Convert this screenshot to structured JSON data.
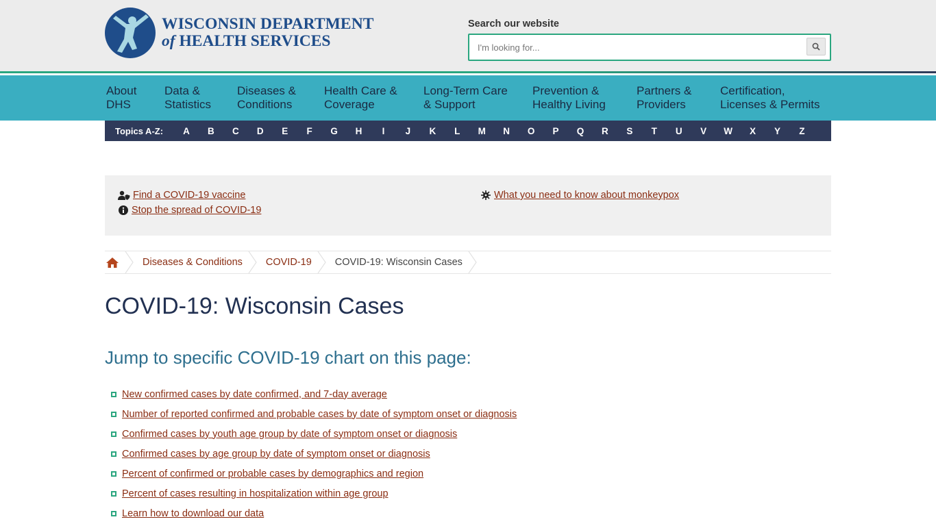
{
  "header": {
    "logo_line1": "WISCONSIN DEPARTMENT",
    "logo_of": "of",
    "logo_line2": "HEALTH SERVICES",
    "search_label": "Search our website",
    "search_placeholder": "I'm looking for..."
  },
  "mainnav": {
    "items": [
      {
        "label": "About\nDHS"
      },
      {
        "label": "Data &\nStatistics"
      },
      {
        "label": "Diseases &\nConditions"
      },
      {
        "label": "Health Care &\nCoverage"
      },
      {
        "label": "Long-Term Care\n& Support"
      },
      {
        "label": "Prevention &\nHealthy Living"
      },
      {
        "label": "Partners &\nProviders"
      },
      {
        "label": "Certification,\nLicenses & Permits"
      }
    ]
  },
  "topics": {
    "label": "Topics A-Z:",
    "letters": [
      "A",
      "B",
      "C",
      "D",
      "E",
      "F",
      "G",
      "H",
      "I",
      "J",
      "K",
      "L",
      "M",
      "N",
      "O",
      "P",
      "Q",
      "R",
      "S",
      "T",
      "U",
      "V",
      "W",
      "X",
      "Y",
      "Z"
    ]
  },
  "alerts": {
    "vaccine": "Find a COVID-19 vaccine",
    "spread": "Stop the spread of COVID-19",
    "monkeypox": "What you need to know about monkeypox"
  },
  "breadcrumb": {
    "items": [
      "Diseases & Conditions",
      "COVID-19",
      "COVID-19: Wisconsin Cases"
    ]
  },
  "page": {
    "title": "COVID-19: Wisconsin Cases",
    "jump_title": "Jump to specific COVID-19 chart on this page:",
    "links": [
      "New confirmed cases by date confirmed, and 7-day average",
      "Number of reported confirmed and probable cases by date of symptom onset or diagnosis",
      "Confirmed cases by youth age group by date of symptom onset or diagnosis",
      "Confirmed cases by age group by date of symptom onset or diagnosis",
      "Percent of confirmed or probable cases by demographics and region",
      "Percent of cases resulting in hospitalization within age group",
      "Learn how to download our data"
    ]
  },
  "colors": {
    "brand_blue": "#1f4d8a",
    "nav_teal": "#3aaec1",
    "az_navy": "#2f3a5a",
    "accent_green": "#2aa67f",
    "link": "#8a2d12"
  }
}
